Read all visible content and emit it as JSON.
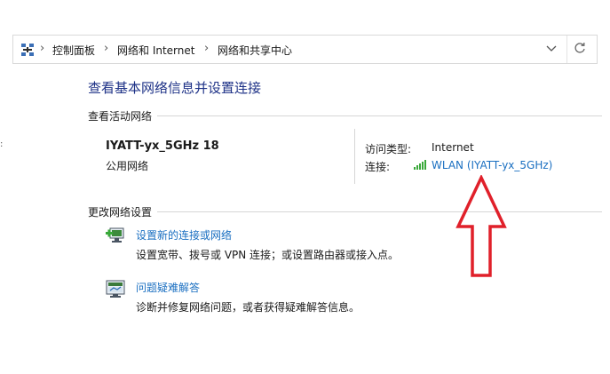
{
  "breadcrumb": {
    "items": [
      "控制面板",
      "网络和 Internet",
      "网络和共享中心"
    ],
    "separator": "›",
    "icons": {
      "root": "network-icon",
      "dropdown": "chevron-down-icon",
      "refresh": "refresh-icon"
    }
  },
  "page": {
    "title": "查看基本网络信息并设置连接"
  },
  "active_networks": {
    "header": "查看活动网络",
    "network_name": "IYATT-yx_5GHz 18",
    "network_category": "公用网络",
    "access_type_label": "访问类型:",
    "access_type_value": "Internet",
    "connections_label": "连接:",
    "connection_link": "WLAN (IYATT-yx_5GHz)"
  },
  "change_settings": {
    "header": "更改网络设置",
    "tasks": [
      {
        "label": "设置新的连接或网络",
        "description": "设置宽带、拨号或 VPN 连接；或设置路由器或接入点。",
        "icon": "new-connection-icon"
      },
      {
        "label": "问题疑难解答",
        "description": "诊断并修复网络问题，或者获得疑难解答信息。",
        "icon": "troubleshoot-icon"
      }
    ]
  },
  "annotation": {
    "icon": "red-up-arrow-icon",
    "color": "#e0202a"
  },
  "colors": {
    "title": "#1e3287",
    "link": "#1a6fc1",
    "signal": "#3aa83a"
  }
}
